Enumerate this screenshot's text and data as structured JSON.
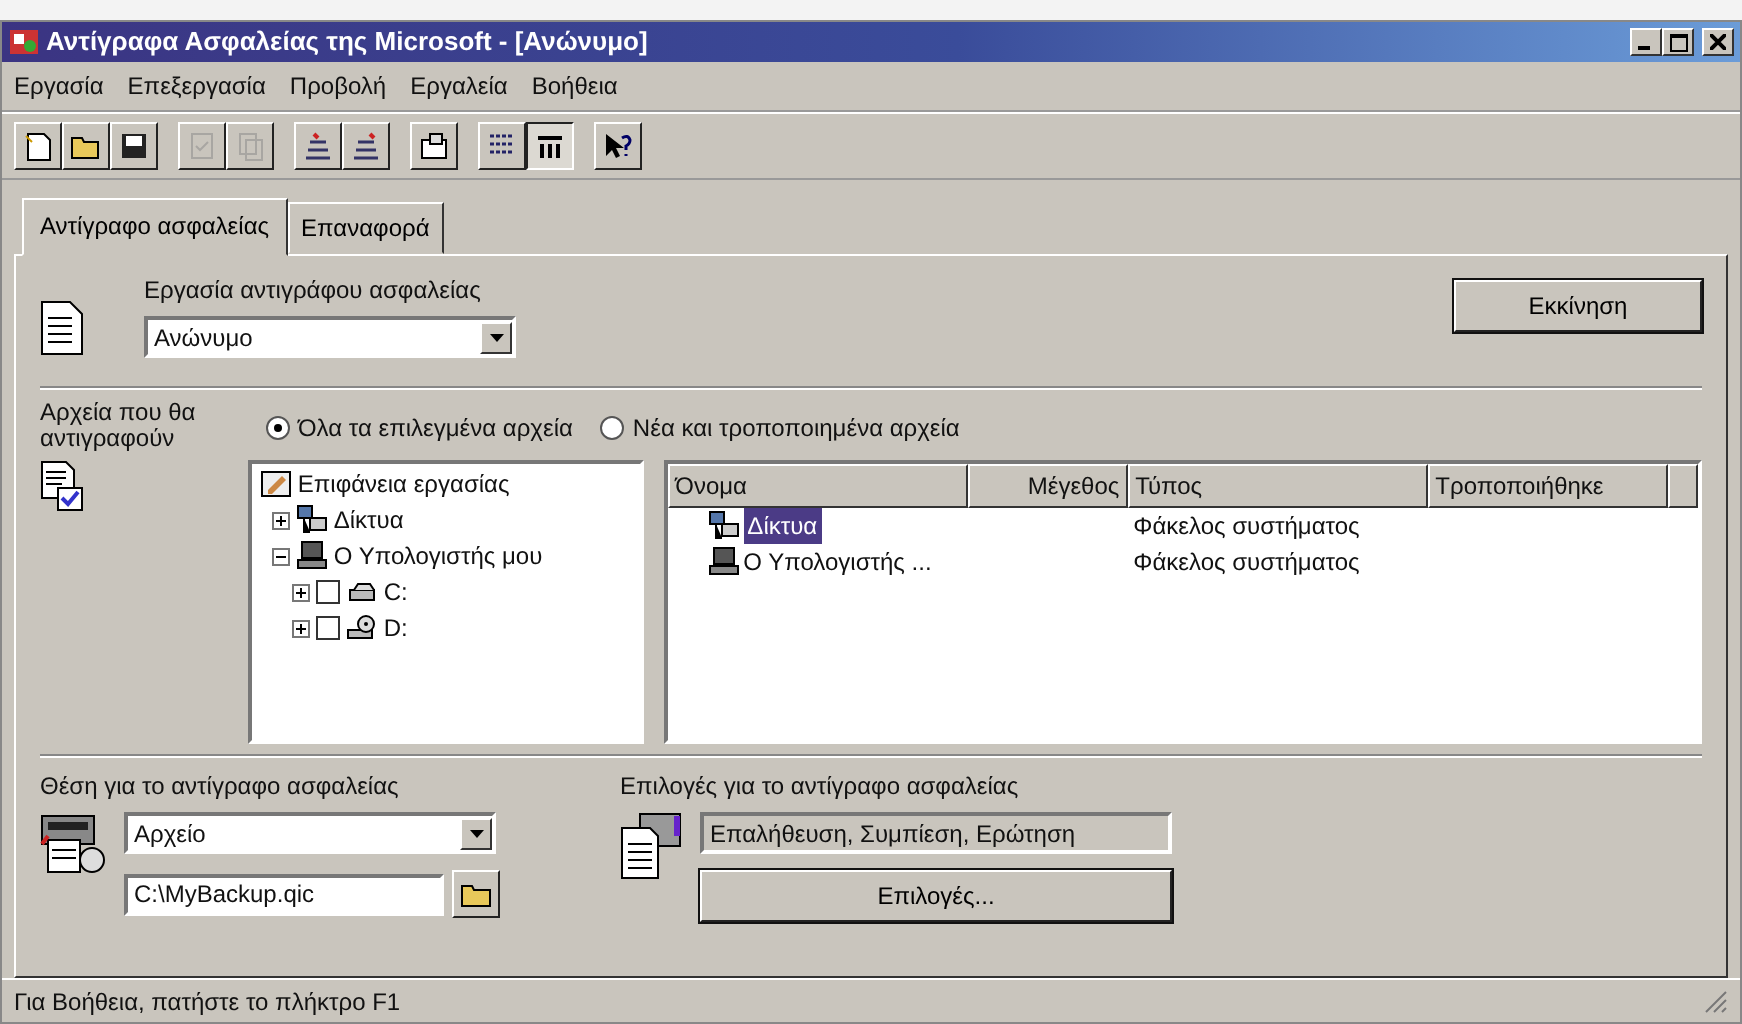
{
  "window": {
    "title": "Αντίγραφα Ασφαλείας της Microsoft - [Ανώνυμο]"
  },
  "menu": [
    "Εργασία",
    "Επεξεργασία",
    "Προβολή",
    "Εργαλεία",
    "Βοήθεια"
  ],
  "toolbar": [
    [
      {
        "kind": "new",
        "disabled": false,
        "pressed": false
      },
      {
        "kind": "open",
        "disabled": false,
        "pressed": false
      },
      {
        "kind": "save",
        "disabled": false,
        "pressed": false
      }
    ],
    [
      {
        "kind": "check",
        "disabled": true,
        "pressed": false
      },
      {
        "kind": "copy",
        "disabled": true,
        "pressed": false
      }
    ],
    [
      {
        "kind": "select",
        "disabled": false,
        "pressed": false
      },
      {
        "kind": "deselect",
        "disabled": false,
        "pressed": false
      }
    ],
    [
      {
        "kind": "properties",
        "disabled": false,
        "pressed": false
      }
    ],
    [
      {
        "kind": "list",
        "disabled": false,
        "pressed": false
      },
      {
        "kind": "details",
        "disabled": false,
        "pressed": true
      }
    ],
    [
      {
        "kind": "help",
        "disabled": false,
        "pressed": false
      }
    ]
  ],
  "tabs": [
    {
      "label": "Αντίγραφο ασφαλείας",
      "selected": true
    },
    {
      "label": "Επαναφορά",
      "selected": false
    }
  ],
  "job": {
    "label": "Εργασία αντιγράφου ασφαλείας",
    "value": "Ανώνυμο",
    "start_button": "Εκκίνηση"
  },
  "files": {
    "label": "Αρχεία που θα αντιγραφούν",
    "radios": [
      {
        "label": "Όλα τα επιλεγμένα αρχεία",
        "selected": true
      },
      {
        "label": "Νέα και τροποποιημένα αρχεία",
        "selected": false
      }
    ],
    "tree": [
      {
        "label": "Επιφάνεια εργασίας",
        "kind": "desktop",
        "children": [
          {
            "label": "Δίκτυα",
            "kind": "network",
            "expanded": false
          },
          {
            "label": "Ο Υπολογιστής μου",
            "kind": "computer",
            "expanded": true,
            "children": [
              {
                "label": "C:",
                "kind": "drive",
                "expanded": false,
                "checked": false
              },
              {
                "label": "D:",
                "kind": "cdrom",
                "expanded": false,
                "checked": false
              }
            ]
          }
        ]
      }
    ],
    "columns": [
      "Όνομα",
      "Μέγεθος",
      "Τύπος",
      "Τροποποιήθηκε"
    ],
    "rows": [
      {
        "kind": "network",
        "name": "Δίκτυα",
        "type": "Φάκελος συστήματος",
        "selected": true
      },
      {
        "kind": "computer",
        "name": "Ο Υπολογιστής ...",
        "type": "Φάκελος συστήματος",
        "selected": false
      }
    ]
  },
  "destination": {
    "label": "Θέση για το αντίγραφο ασφαλείας",
    "value": "Αρχείο",
    "path": "C:\\MyBackup.qic"
  },
  "options": {
    "label": "Επιλογές για το αντίγραφο ασφαλείας",
    "summary": "Επαλήθευση, Συμπίεση, Ερώτηση",
    "button": "Επιλογές..."
  },
  "status_bar": "Για Βοήθεια, πατήστε το πλήκτρο F1"
}
